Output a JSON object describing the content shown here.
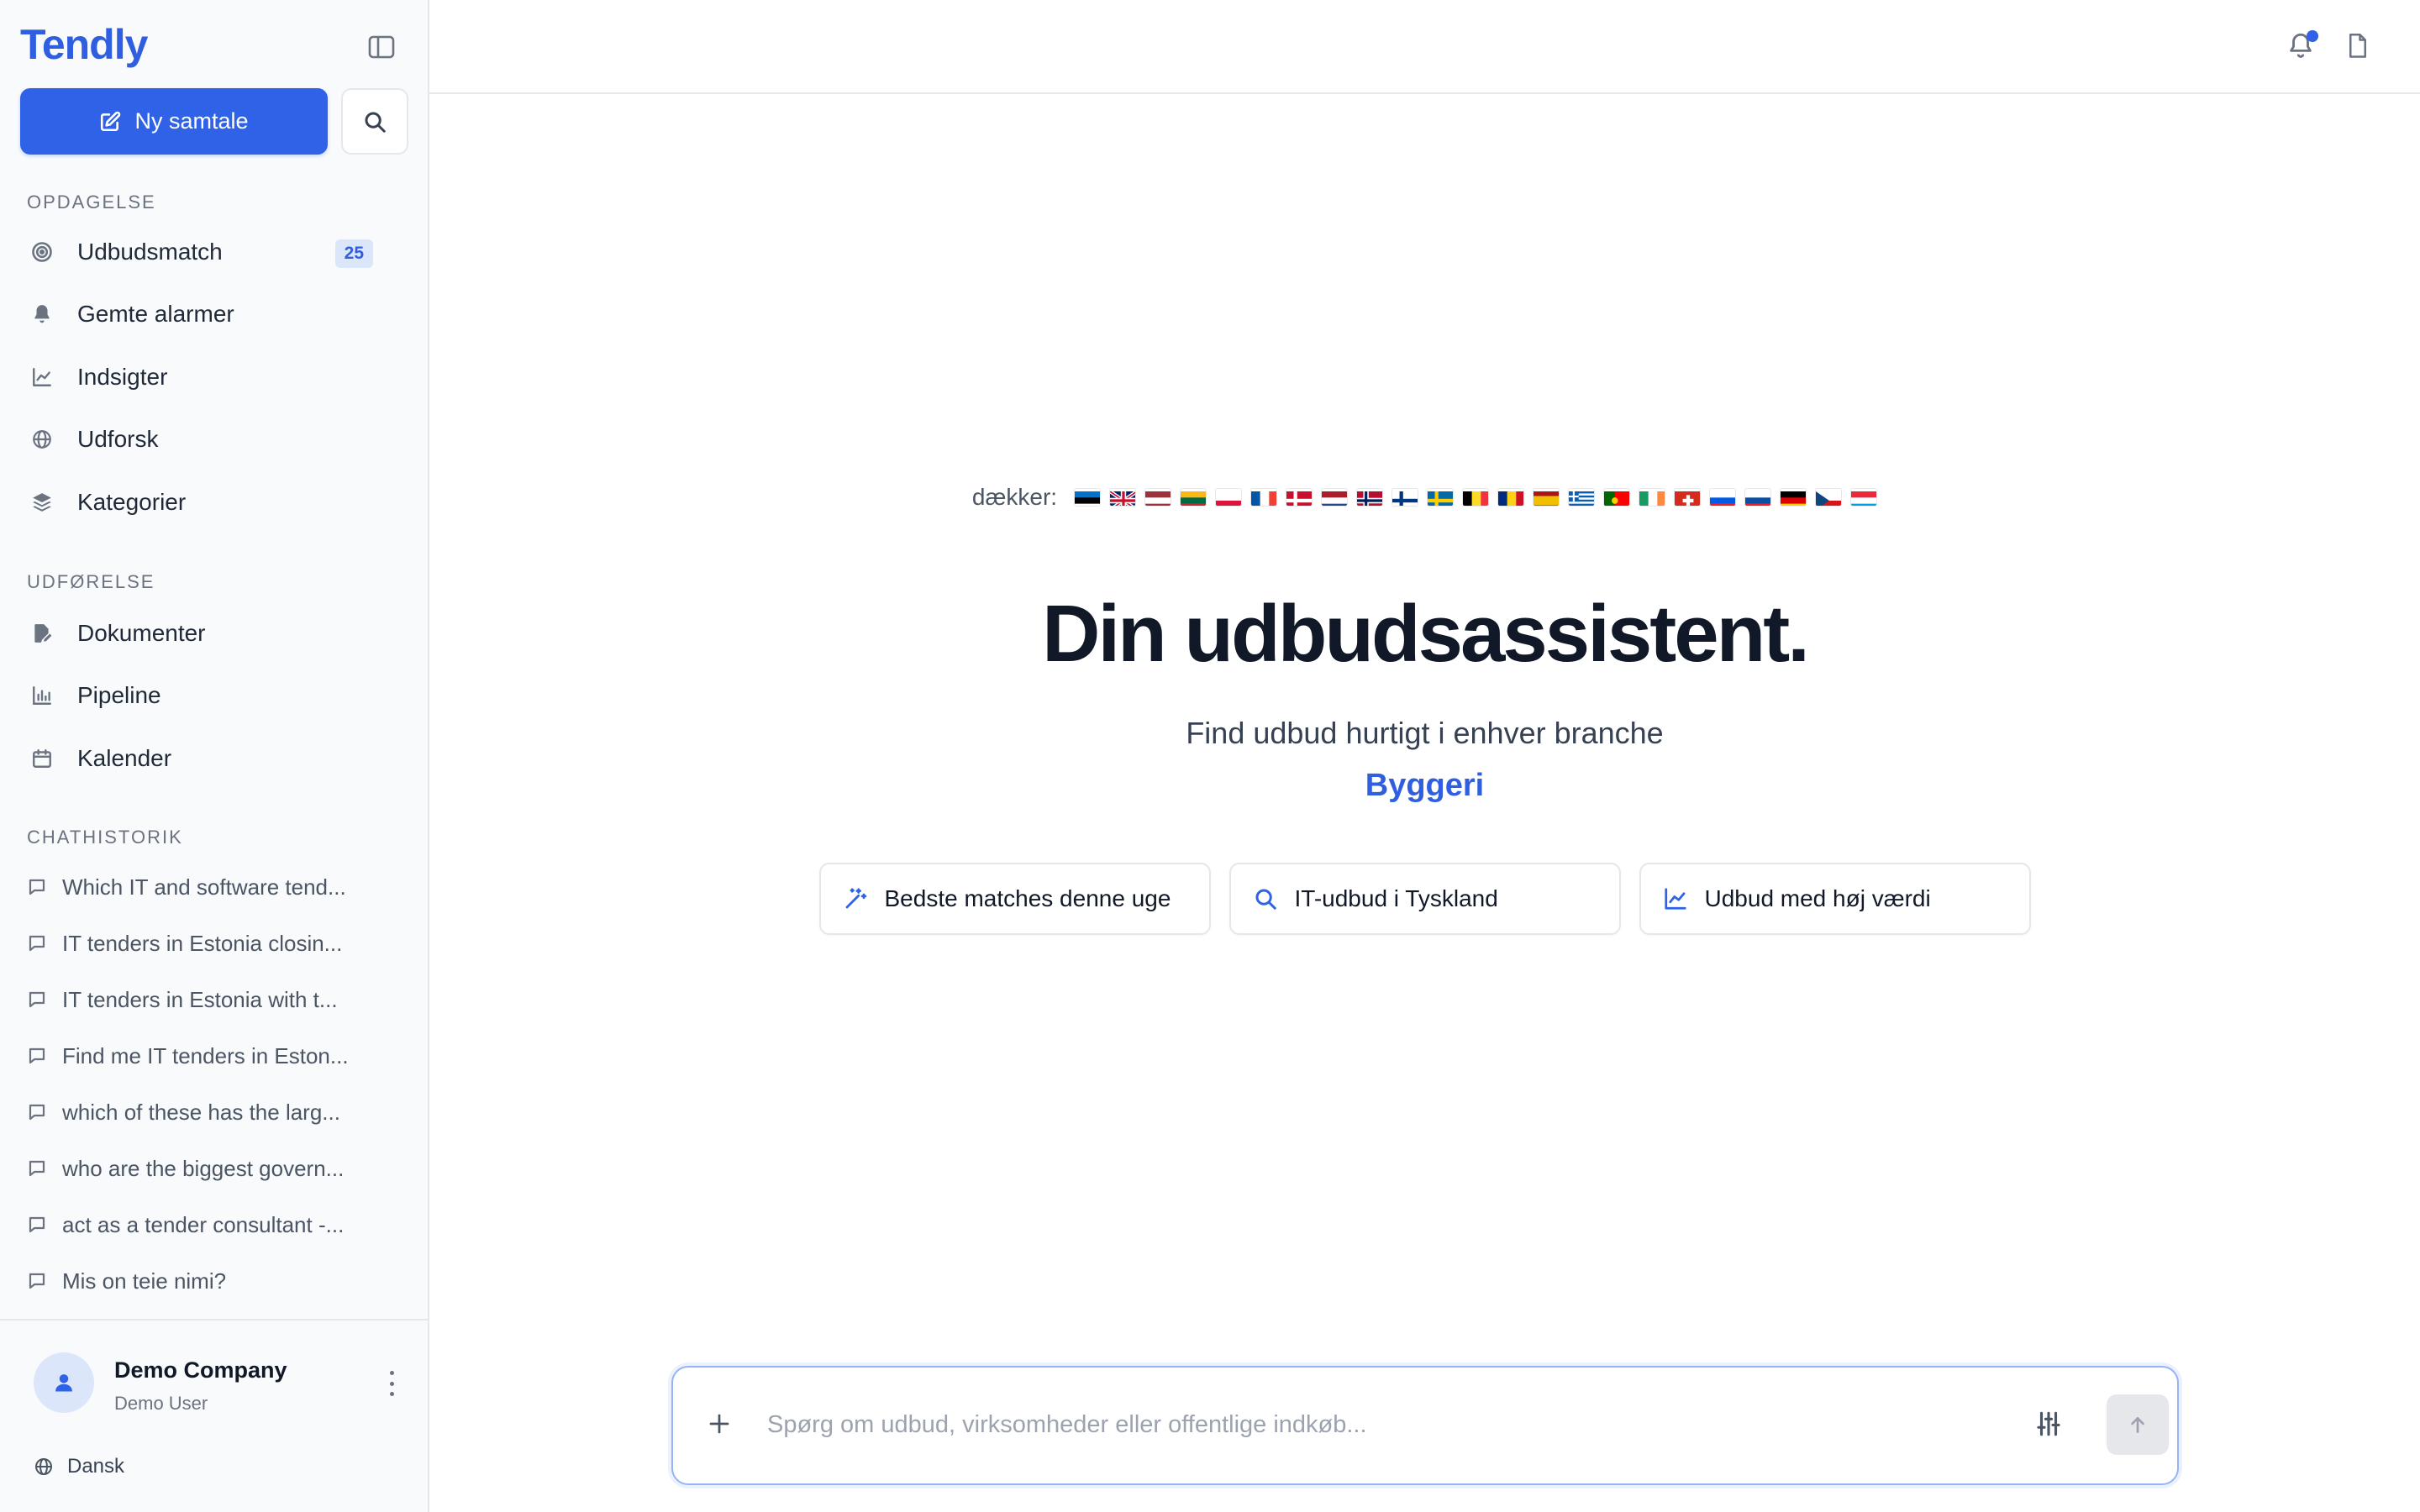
{
  "sidebar": {
    "logo": "Tendly",
    "new_chat_label": "Ny samtale",
    "sections": {
      "discovery": "OPDAGELSE",
      "execution": "UDFØRELSE",
      "history": "CHATHISTORIK"
    },
    "discovery_items": [
      {
        "label": "Udbudsmatch",
        "badge": "25",
        "icon": "target-icon"
      },
      {
        "label": "Gemte alarmer",
        "icon": "bell-icon"
      },
      {
        "label": "Indsigter",
        "icon": "line-chart-icon"
      },
      {
        "label": "Udforsk",
        "icon": "globe-icon"
      },
      {
        "label": "Kategorier",
        "icon": "layers-icon"
      }
    ],
    "execution_items": [
      {
        "label": "Dokumenter",
        "icon": "document-edit-icon"
      },
      {
        "label": "Pipeline",
        "icon": "bar-chart-icon"
      },
      {
        "label": "Kalender",
        "icon": "calendar-icon"
      }
    ],
    "history": [
      "Which IT and software tend...",
      "IT tenders in Estonia closin...",
      "IT tenders in Estonia with t...",
      "Find me IT tenders in Eston...",
      "which of these has the larg...",
      "who are the biggest govern...",
      "act as a tender consultant -...",
      "Mis on teie nimi?"
    ],
    "user": {
      "name": "Demo Company",
      "role": "Demo User"
    },
    "language": "Dansk"
  },
  "main": {
    "covers_label": "dækker:",
    "flags": [
      "EE",
      "GB",
      "LV",
      "LT",
      "PL",
      "FR",
      "DK",
      "NL",
      "NO",
      "FI",
      "SE",
      "BE",
      "RO",
      "ES",
      "GR",
      "PT",
      "IE",
      "CH",
      "SI",
      "SK",
      "DE",
      "CZ",
      "LU"
    ],
    "title": "Din udbudsassistent.",
    "subtitle": "Find udbud hurtigt i enhver branche",
    "highlight": "Byggeri",
    "chips": [
      {
        "label": "Bedste matches denne uge",
        "icon": "magic-wand-icon"
      },
      {
        "label": "IT-udbud i Tyskland",
        "icon": "search-icon"
      },
      {
        "label": "Udbud med høj værdi",
        "icon": "trend-chart-icon"
      }
    ],
    "composer_placeholder": "Spørg om udbud, virksomheder eller offentlige indkøb..."
  },
  "colors": {
    "accent": "#2f62e6",
    "logo": "#2f5fe0",
    "badge_bg": "#dbe6fb"
  }
}
